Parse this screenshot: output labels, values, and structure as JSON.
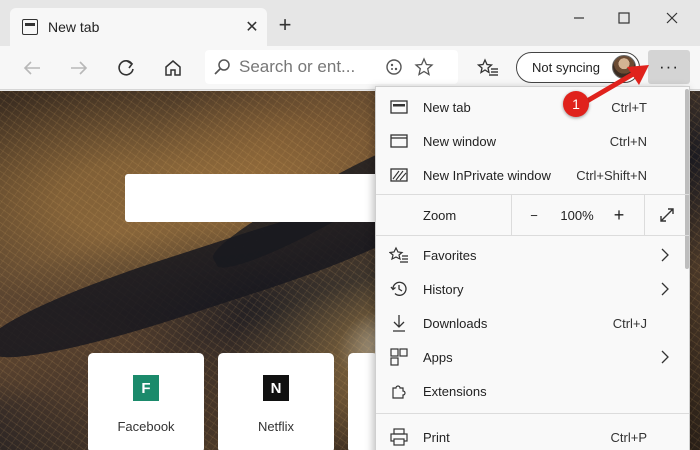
{
  "window": {
    "tab_title": "New tab",
    "tab_close": "✕",
    "new_tab": "+",
    "minimize": "─",
    "maximize": "☐",
    "close": "✕"
  },
  "toolbar": {
    "search_placeholder": "Search or ent...",
    "sync_label": "Not syncing",
    "more_label": "···"
  },
  "page": {
    "tiles": [
      {
        "label": "Facebook",
        "letter": "F",
        "color": "#1b8a6b"
      },
      {
        "label": "Netflix",
        "letter": "N",
        "color": "#111111"
      }
    ]
  },
  "menu": {
    "items": [
      {
        "label": "New tab",
        "shortcut": "Ctrl+T",
        "icon": "new-tab-icon"
      },
      {
        "label": "New window",
        "shortcut": "Ctrl+N",
        "icon": "window-icon"
      },
      {
        "label": "New InPrivate window",
        "shortcut": "Ctrl+Shift+N",
        "icon": "inprivate-icon"
      }
    ],
    "zoom": {
      "label": "Zoom",
      "value": "100%",
      "minus": "−",
      "plus": "+"
    },
    "items2": [
      {
        "label": "Favorites",
        "shortcut": "",
        "icon": "favorites-icon"
      },
      {
        "label": "History",
        "shortcut": "",
        "icon": "history-icon"
      },
      {
        "label": "Downloads",
        "shortcut": "Ctrl+J",
        "icon": "downloads-icon"
      },
      {
        "label": "Apps",
        "shortcut": "",
        "icon": "apps-icon"
      },
      {
        "label": "Extensions",
        "shortcut": "",
        "icon": "extensions-icon"
      },
      {
        "label": "Print",
        "shortcut": "Ctrl+P",
        "icon": "print-icon"
      }
    ]
  },
  "callout": {
    "number": "1",
    "color": "#e0221c"
  }
}
